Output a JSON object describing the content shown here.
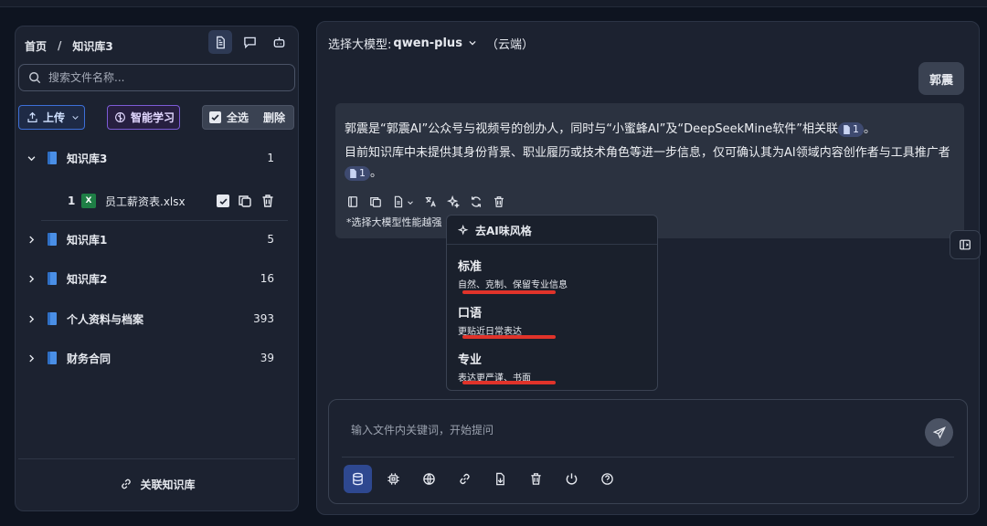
{
  "breadcrumb": {
    "home": "首页",
    "separator": "/",
    "current": "知识库3"
  },
  "search": {
    "placeholder": "搜索文件名称..."
  },
  "toolbar": {
    "upload_label": "上传",
    "learn_label": "智能学习",
    "select_all_label": "全选",
    "delete_label": "删除"
  },
  "tree": [
    {
      "name": "知识库3",
      "count": "1",
      "expanded": true
    },
    {
      "name": "知识库1",
      "count": "5",
      "expanded": false
    },
    {
      "name": "知识库2",
      "count": "16",
      "expanded": false
    },
    {
      "name": "个人资料与档案",
      "count": "393",
      "expanded": false
    },
    {
      "name": "财务合同",
      "count": "39",
      "expanded": false
    }
  ],
  "file": {
    "index": "1",
    "name": "员工薪资表.xlsx",
    "icon_letter": "X"
  },
  "link_kb_label": "关联知识库",
  "model": {
    "prefix": "选择大模型:",
    "name": "qwen-plus",
    "suffix": "（云端）"
  },
  "user_message": "郭震",
  "answer": {
    "p1_text": "郭震是“郭震AI”公众号与视频号的创办人，同时与“小蜜蜂AI”及“DeepSeekMine软件”相关联",
    "p1_end": "。",
    "p2_text": "目前知识库中未提供其身份背景、职业履历或技术角色等进一步信息，仅可确认其为AI领域内容创作者与工具推广者",
    "p2_end": "。",
    "cite_number": "1",
    "tip": "*选择大模型性能越强"
  },
  "dropdown": {
    "header": "去AI味风格",
    "options": [
      {
        "title": "标准",
        "desc": "自然、克制、保留专业信息"
      },
      {
        "title": "口语",
        "desc": "更贴近日常表达"
      },
      {
        "title": "专业",
        "desc": "表达更严谨、书面"
      }
    ]
  },
  "composer": {
    "placeholder": "输入文件内关键词，开始提问"
  },
  "colors": {
    "accent": "#3d6fd8",
    "learn": "#7c5bd6",
    "underline": "#e0332a",
    "excel": "#1e7e45",
    "book": "#4a8fe6"
  }
}
